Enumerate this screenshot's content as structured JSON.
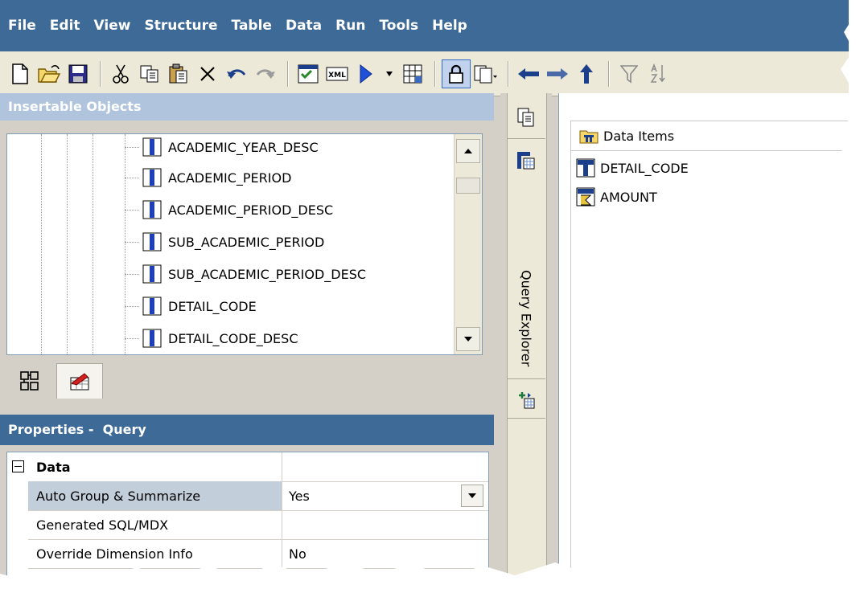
{
  "menu": [
    "File",
    "Edit",
    "View",
    "Structure",
    "Table",
    "Data",
    "Run",
    "Tools",
    "Help"
  ],
  "toolbar": {
    "icons": [
      "new-icon",
      "open-icon",
      "save-icon",
      "cut-icon",
      "copy-icon",
      "paste-icon",
      "delete-icon",
      "undo-icon",
      "redo-icon",
      "validate-icon",
      "xml-icon",
      "run-icon",
      "dropdown-icon",
      "grid-icon",
      "lock-icon",
      "copy-format-icon",
      "back-icon",
      "forward-icon",
      "up-icon",
      "filter-icon",
      "sort-icon"
    ],
    "xml_label": "XML"
  },
  "insertable": {
    "title": "Insertable Objects",
    "items": [
      "ACADEMIC_YEAR_DESC",
      "ACADEMIC_PERIOD",
      "ACADEMIC_PERIOD_DESC",
      "SUB_ACADEMIC_PERIOD",
      "SUB_ACADEMIC_PERIOD_DESC",
      "DETAIL_CODE",
      "DETAIL_CODE_DESC"
    ],
    "tabs": [
      "source-tab-icon",
      "toolbox-tab-icon"
    ]
  },
  "properties": {
    "title": "Properties -  Query",
    "category": "Data",
    "rows": [
      {
        "name": "Auto Group & Summarize",
        "value": "Yes"
      },
      {
        "name": "Generated SQL/MDX",
        "value": ""
      },
      {
        "name": "Override Dimension Info",
        "value": "No"
      }
    ]
  },
  "explorer": {
    "label": "Query Explorer"
  },
  "work": {
    "data_items_title": "Data Items",
    "items": [
      "DETAIL_CODE",
      "AMOUNT"
    ]
  },
  "colors": {
    "menubar": "#3e6a97",
    "insertable_header": "#b0c4de",
    "selected_row": "#c3cedb"
  }
}
